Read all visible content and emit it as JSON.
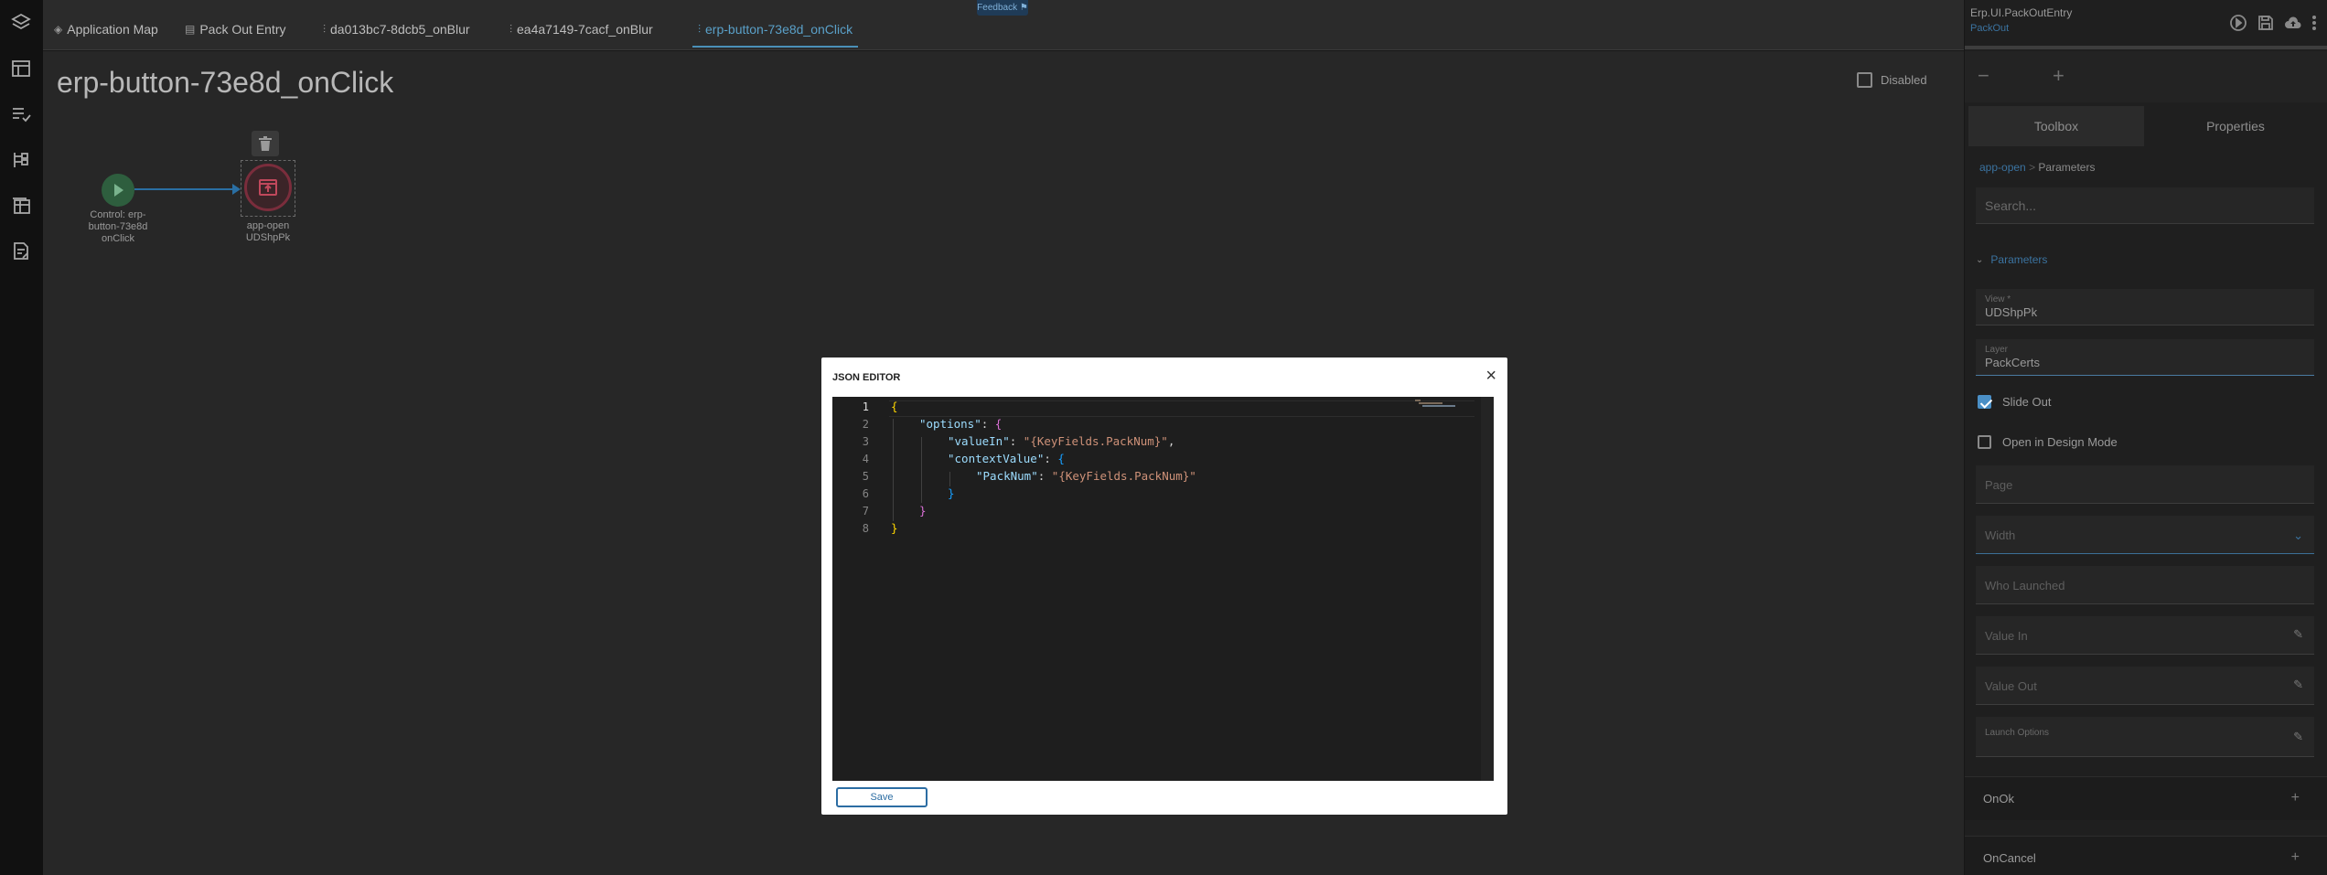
{
  "feedback_label": "Feedback",
  "tabs": [
    {
      "label": "Application Map",
      "icon": "map-icon"
    },
    {
      "label": "Pack Out Entry",
      "icon": "form-icon"
    },
    {
      "label": "da013bc7-8dcb5_onBlur",
      "icon": "event-icon"
    },
    {
      "label": "ea4a7149-7cacf_onBlur",
      "icon": "event-icon"
    },
    {
      "label": "erp-button-73e8d_onClick",
      "icon": "event-icon",
      "active": true
    }
  ],
  "canvas": {
    "title": "erp-button-73e8d_onClick",
    "disabled_label": "Disabled",
    "nodes": {
      "start_label": [
        "Control: erp-",
        "button-73e8d",
        "onClick"
      ],
      "open_label": [
        "app-open",
        "UDShpPk"
      ]
    }
  },
  "right_panel": {
    "title": "Erp.UI.PackOutEntry",
    "subtitle": "PackOut",
    "tabs": [
      "Toolbox",
      "Properties"
    ],
    "crumb_link": "app-open",
    "crumb_sep": ">",
    "crumb_current": "Parameters",
    "search_placeholder": "Search...",
    "section": "Parameters",
    "fields": {
      "view_label": "View *",
      "view_value": "UDShpPk",
      "layer_label": "Layer",
      "layer_value": "PackCerts",
      "slide_out": "Slide Out",
      "design_mode": "Open in Design Mode",
      "page": "Page",
      "width": "Width",
      "who_launched": "Who Launched",
      "value_in": "Value In",
      "value_out": "Value Out",
      "launch_options": "Launch Options"
    },
    "events": [
      "OnOk",
      "OnCancel"
    ]
  },
  "dialog": {
    "title": "JSON EDITOR",
    "close": "×",
    "save_label": "Save",
    "line_numbers": [
      "1",
      "2",
      "3",
      "4",
      "5",
      "6",
      "7",
      "8"
    ],
    "code": {
      "l1_open": "{",
      "l2_key": "\"options\"",
      "l2_colon": ": ",
      "l2_open": "{",
      "l3_key": "\"valueIn\"",
      "l3_colon": ": ",
      "l3_val": "\"{KeyFields.PackNum}\"",
      "l3_comma": ",",
      "l4_key": "\"contextValue\"",
      "l4_colon": ": ",
      "l4_open": "{",
      "l5_key": "\"PackNum\"",
      "l5_colon": ": ",
      "l5_val": "\"{KeyFields.PackNum}\"",
      "l6_close": "}",
      "l7_close": "}",
      "l8_close": "}"
    }
  }
}
